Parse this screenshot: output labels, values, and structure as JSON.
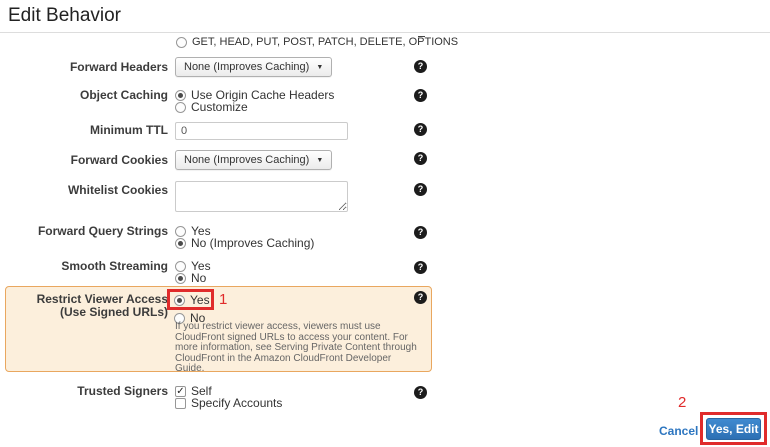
{
  "page": {
    "title": "Edit Behavior"
  },
  "icons": {
    "help": "?",
    "check": "✓",
    "caret": "▼"
  },
  "annotations": {
    "step1": "1",
    "step2": "2"
  },
  "form": {
    "http_methods": {
      "visible_option": "GET, HEAD, PUT, POST, PATCH, DELETE, OPTIONS"
    },
    "forward_headers": {
      "label": "Forward Headers",
      "value": "None (Improves Caching)"
    },
    "object_caching": {
      "label": "Object Caching",
      "options": [
        "Use Origin Cache Headers",
        "Customize"
      ],
      "selected": "Use Origin Cache Headers"
    },
    "minimum_ttl": {
      "label": "Minimum TTL",
      "value": "0"
    },
    "forward_cookies": {
      "label": "Forward Cookies",
      "value": "None (Improves Caching)"
    },
    "whitelist_cookies": {
      "label": "Whitelist Cookies",
      "value": ""
    },
    "forward_query_strings": {
      "label": "Forward Query Strings",
      "options": [
        "Yes",
        "No (Improves Caching)"
      ],
      "selected": "No (Improves Caching)"
    },
    "smooth_streaming": {
      "label": "Smooth Streaming",
      "options": [
        "Yes",
        "No"
      ],
      "selected": "No"
    },
    "restrict_viewer_access": {
      "label_line1": "Restrict Viewer Access",
      "label_line2": "(Use Signed URLs)",
      "options": [
        "Yes",
        "No"
      ],
      "selected": "Yes",
      "help_text": "If you restrict viewer access, viewers must use CloudFront signed URLs to access your content. For more information, see Serving Private Content through CloudFront in the Amazon CloudFront Developer Guide."
    },
    "trusted_signers": {
      "label": "Trusted Signers",
      "options": [
        "Self",
        "Specify Accounts"
      ],
      "checked": [
        "Self"
      ]
    }
  },
  "footer": {
    "cancel_label": "Cancel",
    "submit_label": "Yes, Edit"
  },
  "colors": {
    "annotation_red": "#e02b2b",
    "highlight_bg": "#fcefdc",
    "highlight_border": "#e9a75f",
    "button_blue": "#2d70b4",
    "link_blue": "#2d76c0"
  }
}
